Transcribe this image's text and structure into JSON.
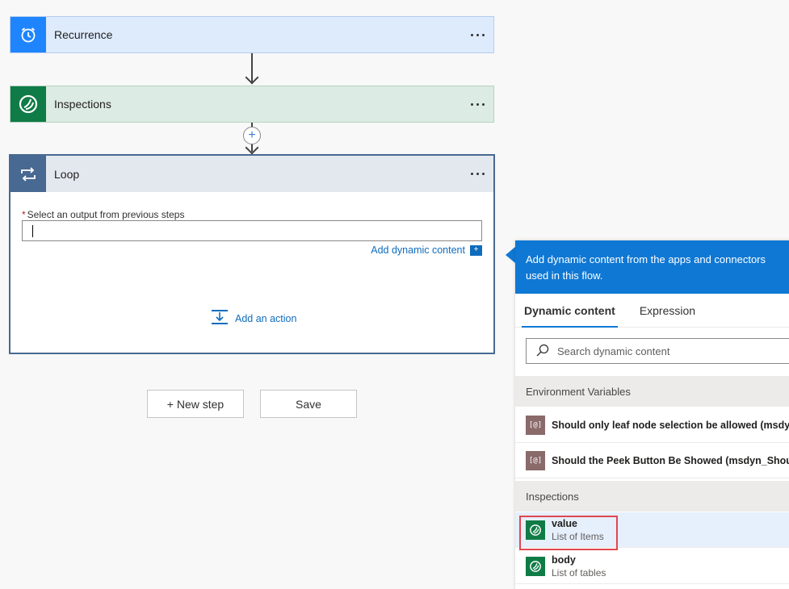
{
  "flow": {
    "steps": [
      {
        "title": "Recurrence",
        "icon": "alarm-clock-icon"
      },
      {
        "title": "Inspections",
        "icon": "dataverse-icon"
      }
    ],
    "loop": {
      "title": "Loop",
      "field_label": "Select an output from previous steps",
      "required_mark": "*",
      "input_value": "",
      "add_dynamic_label": "Add dynamic content",
      "add_action_label": "Add an action"
    },
    "new_step_label": "+ New step",
    "save_label": "Save"
  },
  "panel": {
    "header": "Add dynamic content from the apps and connectors used in this flow.",
    "tabs": [
      {
        "label": "Dynamic content",
        "active": true
      },
      {
        "label": "Expression",
        "active": false
      }
    ],
    "search_placeholder": "Search dynamic content",
    "sections": [
      {
        "title": "Environment Variables",
        "items": [
          {
            "label": "Should only leaf node selection be allowed (msdyn_Al"
          },
          {
            "label": "Should the Peek Button Be Showed (msdyn_ShouldSh"
          }
        ]
      },
      {
        "title": "Inspections",
        "items": [
          {
            "label": "value",
            "sublabel": "List of Items",
            "selected": true
          },
          {
            "label": "body",
            "sublabel": "List of tables",
            "selected": false
          }
        ]
      }
    ]
  },
  "colors": {
    "accent": "#0f78d4",
    "recurrence": "#1f85ff",
    "dataverse": "#0f7b46",
    "loop": "#486991",
    "highlight": "#e0474f"
  }
}
